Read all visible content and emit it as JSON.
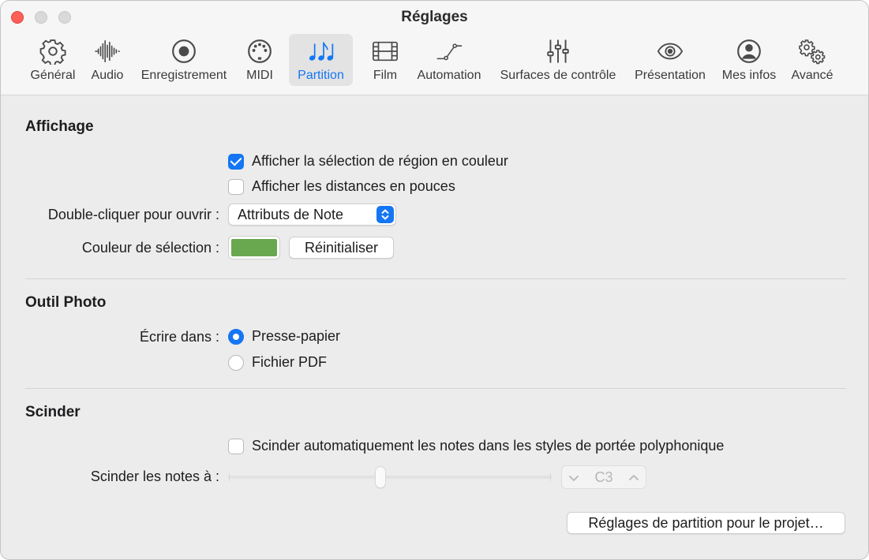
{
  "window": {
    "title": "Réglages"
  },
  "tabs": [
    {
      "id": "general",
      "label": "Général",
      "icon": "gear-icon"
    },
    {
      "id": "audio",
      "label": "Audio",
      "icon": "waveform-icon"
    },
    {
      "id": "recording",
      "label": "Enregistrement",
      "icon": "record-icon"
    },
    {
      "id": "midi",
      "label": "MIDI",
      "icon": "midi-connector-icon"
    },
    {
      "id": "score",
      "label": "Partition",
      "icon": "music-notes-icon",
      "active": true
    },
    {
      "id": "film",
      "label": "Film",
      "icon": "film-icon"
    },
    {
      "id": "automation",
      "label": "Automation",
      "icon": "automation-curve-icon"
    },
    {
      "id": "control-surfaces",
      "label": "Surfaces de contrôle",
      "icon": "sliders-icon"
    },
    {
      "id": "display",
      "label": "Présentation",
      "icon": "eye-icon"
    },
    {
      "id": "my-info",
      "label": "Mes infos",
      "icon": "person-icon"
    },
    {
      "id": "advanced",
      "label": "Avancé",
      "icon": "gears-icon"
    }
  ],
  "display_section": {
    "title": "Affichage",
    "color_region_selection": {
      "label": "Afficher la sélection de région en couleur",
      "checked": true
    },
    "distances_inches": {
      "label": "Afficher les distances en pouces",
      "checked": false
    },
    "double_click_label": "Double-cliquer pour ouvrir :",
    "double_click_value": "Attributs de Note",
    "selection_color_label": "Couleur de sélection :",
    "selection_color": "#6aa84f",
    "reset_label": "Réinitialiser"
  },
  "photo_section": {
    "title": "Outil Photo",
    "write_to_label": "Écrire dans :",
    "options": [
      {
        "label": "Presse-papier",
        "selected": true
      },
      {
        "label": "Fichier PDF",
        "selected": false
      }
    ]
  },
  "split_section": {
    "title": "Scinder",
    "auto_split": {
      "label": "Scinder automatiquement les notes dans les styles de portée polyphonique",
      "checked": false
    },
    "split_at_label": "Scinder les notes à :",
    "split_note": "C3",
    "slider_position": 0.47
  },
  "project_score_settings_label": "Réglages de partition pour le projet…",
  "colors": {
    "accent": "#1476f3",
    "close": "#fe5f57",
    "selection_green": "#6aa84f"
  }
}
